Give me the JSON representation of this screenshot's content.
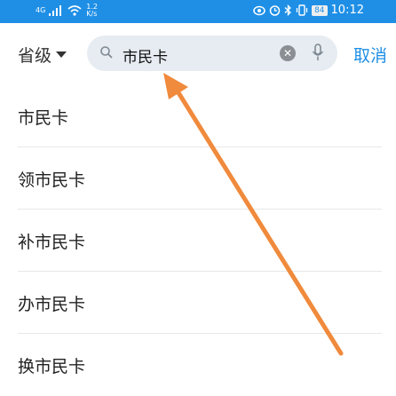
{
  "status_bar": {
    "network_label": "4G",
    "speed_value": "1.2",
    "speed_unit": "K/s",
    "battery": "84",
    "time": "10:12"
  },
  "search_header": {
    "province_label": "省级",
    "search_value": "市民卡",
    "cancel_label": "取消"
  },
  "suggestions": [
    {
      "label": "市民卡"
    },
    {
      "label": "领市民卡"
    },
    {
      "label": "补市民卡"
    },
    {
      "label": "办市民卡"
    },
    {
      "label": "换市民卡"
    }
  ],
  "colors": {
    "accent": "#1f8fe6",
    "annotation_arrow": "#f08a3c"
  },
  "icons": [
    "signal-icon",
    "wifi-icon",
    "eye-icon",
    "alarm-icon",
    "bluetooth-icon",
    "vibrate-icon",
    "search-icon",
    "clear-icon",
    "mic-icon"
  ]
}
